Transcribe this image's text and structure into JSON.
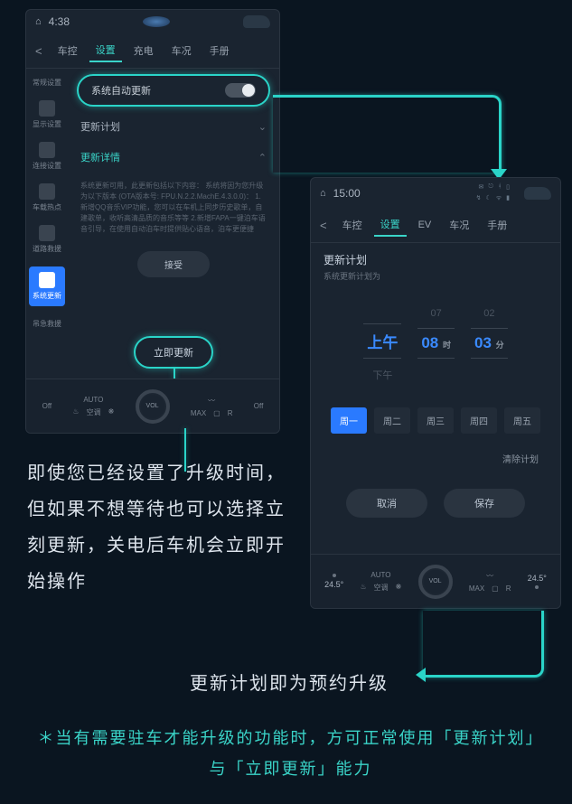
{
  "left": {
    "statusbar": {
      "time": "4:38"
    },
    "tabs": {
      "back": "<",
      "items": [
        "车控",
        "设置",
        "充电",
        "车况",
        "手册"
      ],
      "activeIndex": 1
    },
    "side": [
      "常规设置",
      "显示设置",
      "连接设置",
      "车载热点",
      "道路救援",
      "系统更新",
      "吊急救援"
    ],
    "sideActiveIndex": 5,
    "autoUpdate": {
      "label": "系统自动更新"
    },
    "updatePlan": {
      "label": "更新计划"
    },
    "updateInfo": {
      "label": "更新详情"
    },
    "updateBody": "系统更新可用，此更新包括以下内容：\n系统将因为您升级为以下版本 (OTA版本号: FPU.N.2.2.MachE.4.3.0.0)：\n1.新增QQ音乐VIP功能，您可以在车机上同步历史歌单，自建歌单，收听高清品质的音乐等等\n2.新增FAPA一键泊车语音引导，在使用自动泊车时提供贴心语音，泊车更便捷",
    "acceptLabel": "接受",
    "updateNowLabel": "立即更新",
    "dock": {
      "off1": "Off",
      "auto": "AUTO",
      "vol": "VOL",
      "off2": "Off",
      "sub": [
        "空调",
        "",
        "MAX",
        "R"
      ]
    }
  },
  "right": {
    "statusbar": {
      "time": "15:00"
    },
    "tabs": {
      "back": "<",
      "items": [
        "车控",
        "设置",
        "EV",
        "车况",
        "手册"
      ],
      "activeIndex": 1
    },
    "planTitle": "更新计划",
    "planSub": "系统更新计划为",
    "picker": {
      "ampm": {
        "above": "",
        "selected": "上午",
        "below": "下午"
      },
      "hour": {
        "above": "07",
        "selected": "08",
        "suffix": "时"
      },
      "minute": {
        "above": "02",
        "selected": "03",
        "suffix": "分"
      }
    },
    "days": [
      "周一",
      "周二",
      "周三",
      "周四",
      "周五"
    ],
    "dayActiveIndex": 0,
    "clear": "清除计划",
    "cancel": "取消",
    "save": "保存",
    "dock": {
      "temp": "24.5°",
      "auto": "AUTO",
      "vol": "VOL",
      "sub": [
        "空调",
        "",
        "MAX",
        "R"
      ]
    }
  },
  "para": "即使您已经设置了升级时间，但如果不想等待也可以选择立刻更新，关电后车机会立即开始操作",
  "captionRight": "更新计划即为预约升级",
  "footnote": "＊当有需要驻车才能升级的功能时，方可正常使用「更新计划」与「立即更新」能力"
}
